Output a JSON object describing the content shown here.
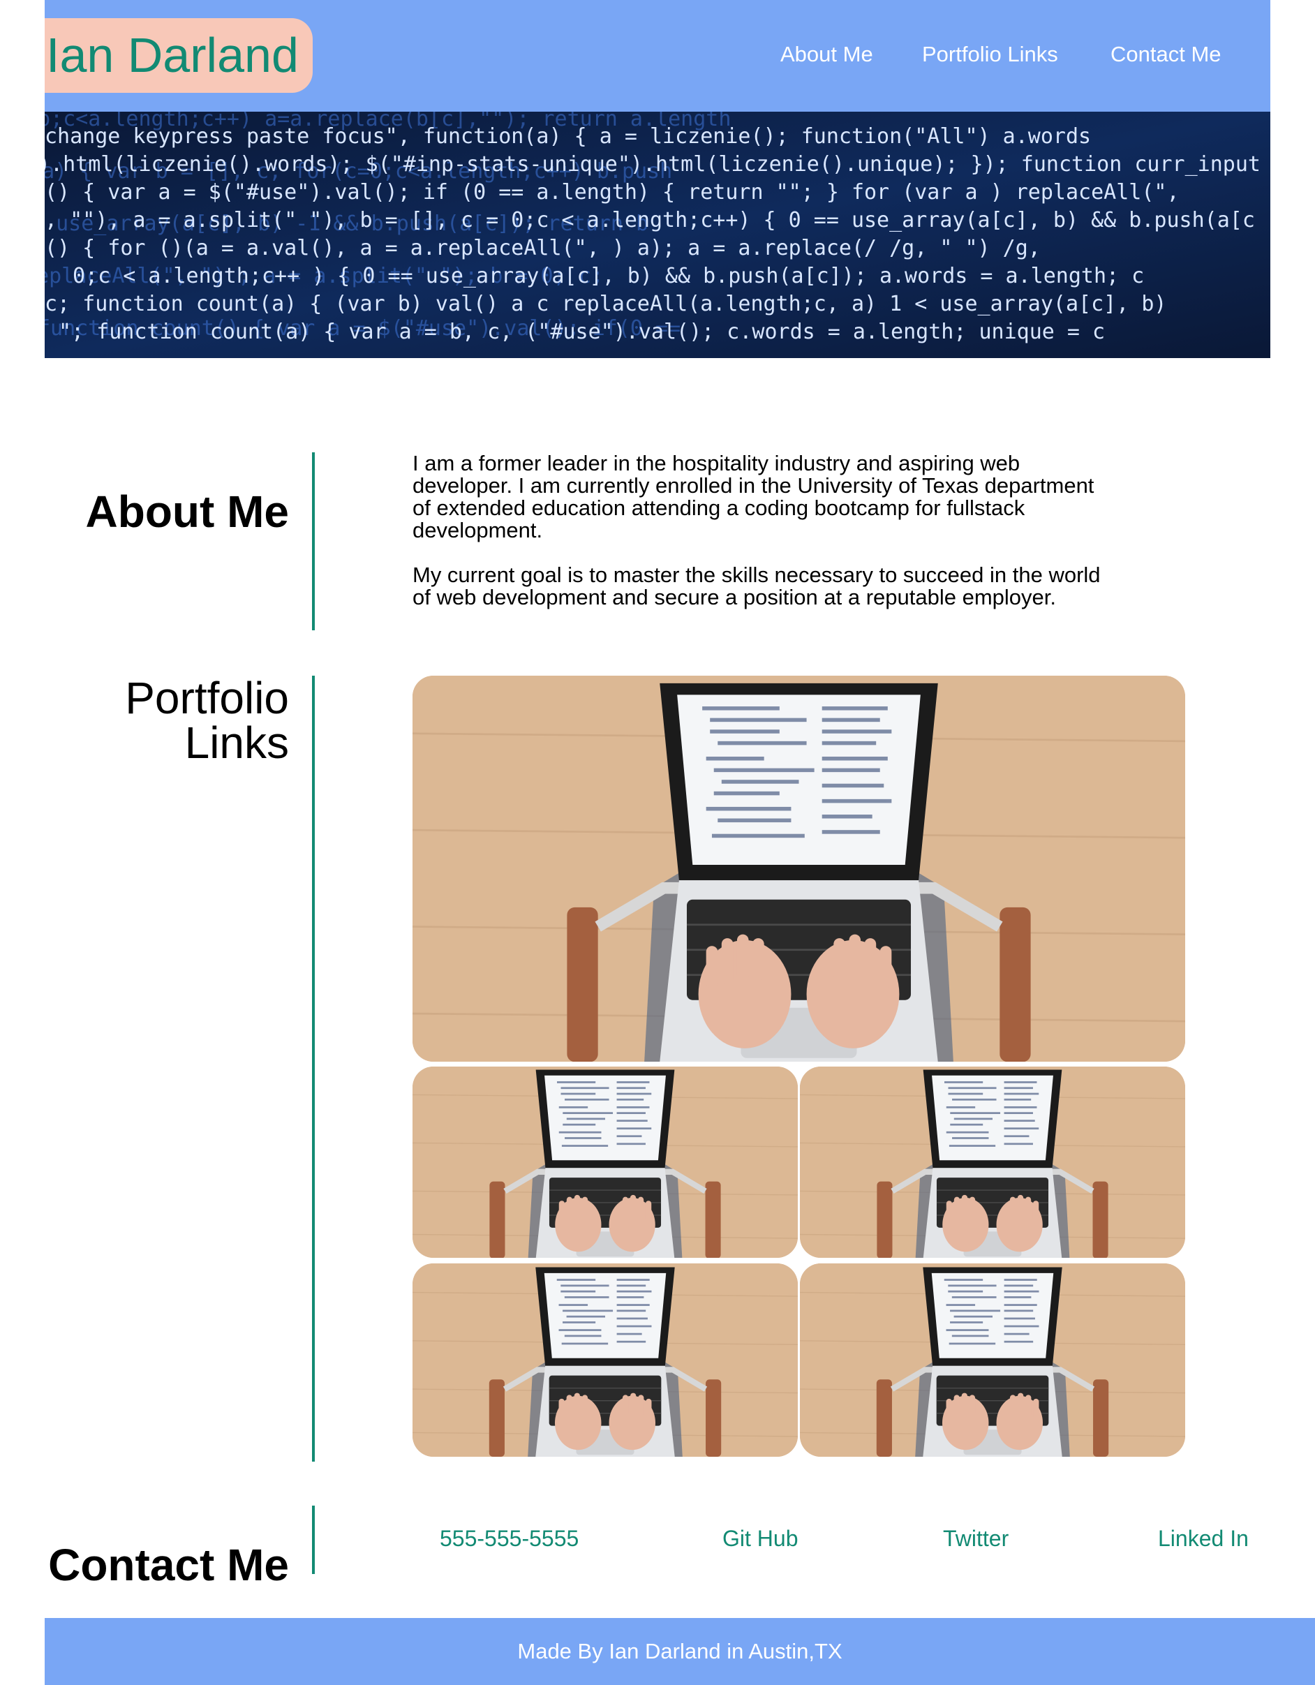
{
  "header": {
    "brand": "Ian Darland",
    "nav": [
      {
        "label": "About Me"
      },
      {
        "label": "Portfolio Links"
      },
      {
        "label": "Contact Me"
      }
    ]
  },
  "colors": {
    "header_bg": "#79a6f5",
    "brand_bg": "#f8c8b8",
    "accent": "#128a73",
    "text": "#000000"
  },
  "about": {
    "title": "About Me",
    "paragraphs": [
      "I am a former leader in the hospitality industry and aspiring web developer. I am currently enrolled in the University of Texas department of extended education attending a coding bootcamp for fullstack development.",
      "My current goal is to master the skills necessary to succeed in the world of web development and secure a position at a reputable employer."
    ]
  },
  "portfolio": {
    "title_line1": "Portfolio",
    "title_line2": "Links",
    "items": [
      {
        "image": "laptop-coding-photo"
      },
      {
        "image": "laptop-coding-photo"
      },
      {
        "image": "laptop-coding-photo"
      },
      {
        "image": "laptop-coding-photo"
      },
      {
        "image": "laptop-coding-photo"
      }
    ]
  },
  "contact": {
    "title": "Contact Me",
    "links": [
      {
        "label": "555-555-5555"
      },
      {
        "label": "Git Hub"
      },
      {
        "label": "Twitter"
      },
      {
        "label": "Linked In"
      }
    ]
  },
  "footer": {
    "text": "Made By Ian Darland in Austin,TX"
  }
}
